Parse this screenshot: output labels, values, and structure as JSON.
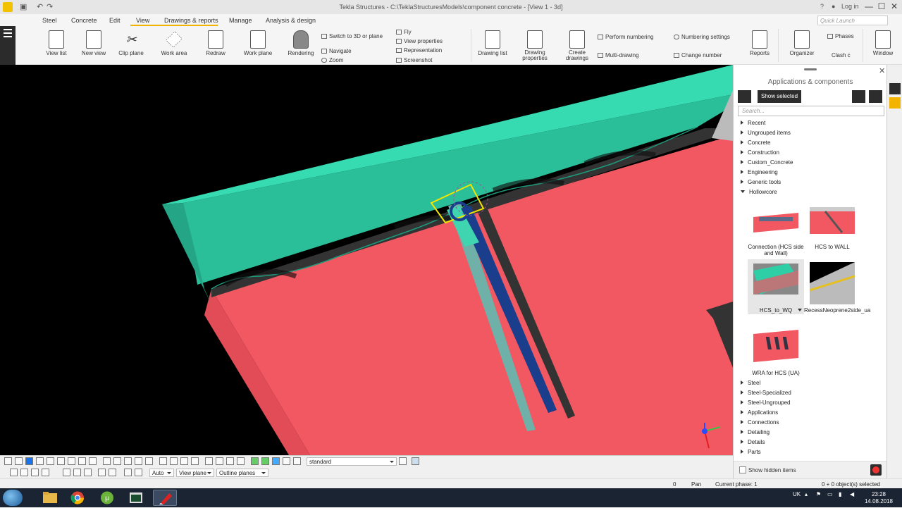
{
  "titlebar": {
    "title": "Tekla Structures - C:\\TeklaStructuresModels\\component concrete - [View 1 - 3d]",
    "help": "?",
    "login": "Log in",
    "minimize": "—",
    "maximize": "☐",
    "close": "✕"
  },
  "menu": {
    "tabs": [
      "Steel",
      "Concrete",
      "Edit",
      "View",
      "Drawings & reports",
      "Manage",
      "Analysis & design"
    ],
    "active_tab": "View",
    "quick_launch_placeholder": "Quick Launch"
  },
  "ribbon": {
    "buttons": {
      "view_list": "View list",
      "new_view": "New view",
      "clip_plane": "Clip plane",
      "work_area": "Work area",
      "redraw": "Redraw",
      "work_plane": "Work plane",
      "rendering": "Rendering",
      "drawing_list": "Drawing list",
      "drawing_properties": "Drawing properties",
      "create_drawings": "Create drawings",
      "reports": "Reports",
      "organizer": "Organizer",
      "window": "Window"
    },
    "small": {
      "switch_3d": "Switch to 3D or plane",
      "navigate": "Navigate",
      "zoom": "Zoom",
      "fly": "Fly",
      "view_properties": "View properties",
      "representation": "Representation",
      "screenshot": "Screenshot",
      "perform_numbering": "Perform numbering",
      "multi_drawing": "Multi-drawing",
      "numbering_settings": "Numbering settings",
      "change_number": "Change number",
      "phases": "Phases",
      "clash_check": "Clash c"
    }
  },
  "panel": {
    "title": "Applications & components",
    "show_selected": "Show selected",
    "search_placeholder": "Search...",
    "categories_top": [
      "Recent",
      "Ungrouped items",
      "Concrete",
      "Construction",
      "Custom_Concrete",
      "Engineering",
      "Generic tools"
    ],
    "expanded_category": "Hollowcore",
    "components": [
      {
        "name": "Connection (HCS side and Wall)"
      },
      {
        "name": "HCS to WALL"
      },
      {
        "name": "HCS_to_WQ"
      },
      {
        "name": "RecessNeoprene2side_ua"
      },
      {
        "name": "WRA for HCS (UA)"
      }
    ],
    "categories_bottom": [
      "Steel",
      "Steel-Specialized",
      "Steel-Ungrouped",
      "Applications",
      "Connections",
      "Detailing",
      "Details",
      "Parts"
    ],
    "show_hidden": "Show hidden items"
  },
  "toolbar": {
    "filter_value": "standard",
    "auto_value": "Auto",
    "view_plane_value": "View plane",
    "outline_value": "Outline planes"
  },
  "status": {
    "counter": "0",
    "mode": "Pan",
    "phase": "Current phase: 1",
    "selection": "0 + 0 object(s) selected"
  },
  "taskbar": {
    "lang": "UK",
    "time": "23:28",
    "date": "14.08.2018"
  },
  "colors": {
    "slab": "#f25862",
    "wall": "#2ecfa6",
    "rebar": "#1b3e8c",
    "selection": "#f2e600",
    "accent": "#f2b400"
  }
}
